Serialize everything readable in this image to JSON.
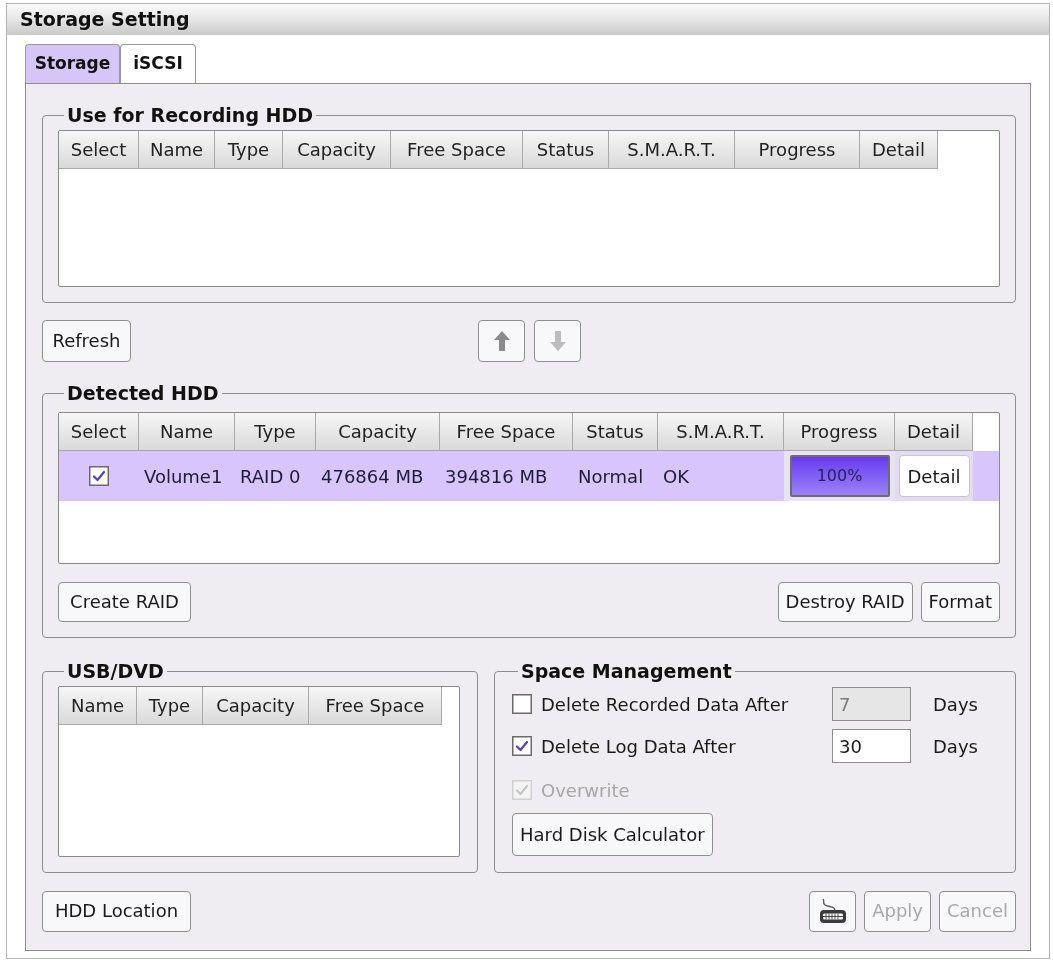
{
  "window": {
    "title": "Storage Setting"
  },
  "tabs": [
    {
      "label": "Storage",
      "selected": true
    },
    {
      "label": "iSCSI",
      "selected": false
    }
  ],
  "recording_hdd": {
    "title": "Use for Recording HDD",
    "columns": [
      "Select",
      "Name",
      "Type",
      "Capacity",
      "Free Space",
      "Status",
      "S.M.A.R.T.",
      "Progress",
      "Detail"
    ]
  },
  "refresh_button": {
    "label": "Refresh"
  },
  "move_buttons": [
    {
      "kind": "up",
      "disabled": false
    },
    {
      "kind": "down",
      "disabled": true
    }
  ],
  "detected_hdd": {
    "title": "Detected HDD",
    "columns": [
      "Select",
      "Name",
      "Type",
      "Capacity",
      "Free Space",
      "Status",
      "S.M.A.R.T.",
      "Progress",
      "Detail"
    ],
    "rows": [
      {
        "selected": true,
        "checked": true,
        "name": "Volume1",
        "type": "RAID 0",
        "capacity": "476864 MB",
        "free_space": "394816 MB",
        "status": "Normal",
        "smart": "OK",
        "progress": {
          "level": 1,
          "reading": "100%"
        },
        "detail_button": "Detail"
      }
    ],
    "left_buttons": [
      "Create RAID"
    ],
    "right_buttons": [
      "Destroy RAID",
      "Format"
    ]
  },
  "usb_dvd": {
    "title": "USB/DVD",
    "columns": [
      "Name",
      "Type",
      "Capacity",
      "Free Space"
    ]
  },
  "space_management": {
    "title": "Space Management",
    "options": [
      {
        "kind": "days",
        "label": "Delete Recorded Data After",
        "checked": false,
        "disabled": false,
        "value": "7",
        "value_disabled": true,
        "unit": "Days"
      },
      {
        "kind": "days",
        "label": "Delete Log Data After",
        "checked": true,
        "disabled": false,
        "value": "30",
        "value_disabled": false,
        "unit": "Days"
      },
      {
        "kind": "checkbox",
        "label": "Overwrite",
        "checked": true,
        "disabled": true
      }
    ],
    "calculator_button": "Hard Disk Calculator"
  },
  "footer": {
    "left_button": "HDD Location",
    "actions": [
      {
        "kind": "keyboard",
        "disabled": false
      },
      {
        "kind": "text",
        "label": "Apply",
        "disabled": true
      },
      {
        "kind": "text",
        "label": "Cancel",
        "disabled": true
      }
    ]
  }
}
